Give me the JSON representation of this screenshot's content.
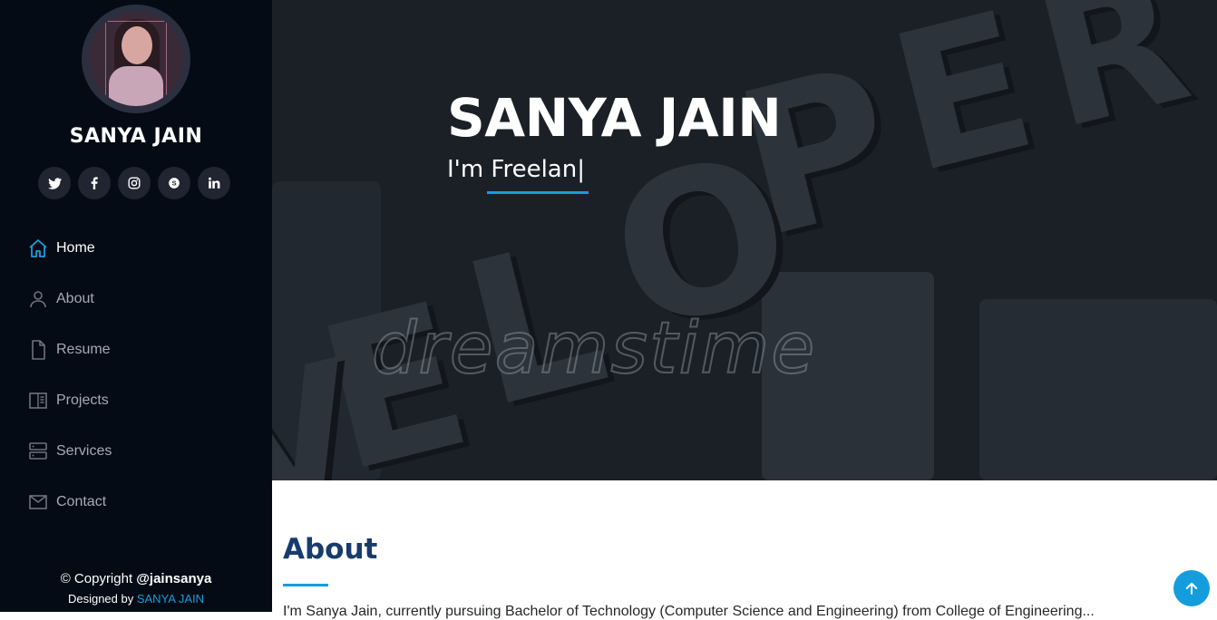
{
  "sidebar": {
    "name": "SANYA JAIN",
    "socials": [
      {
        "icon": "twitter-icon",
        "glyph": "t"
      },
      {
        "icon": "facebook-icon",
        "glyph": "f"
      },
      {
        "icon": "instagram-icon",
        "glyph": "◎"
      },
      {
        "icon": "skype-icon",
        "glyph": "S"
      },
      {
        "icon": "linkedin-icon",
        "glyph": "in"
      }
    ],
    "nav": [
      {
        "label": "Home",
        "icon": "home-icon",
        "active": true
      },
      {
        "label": "About",
        "icon": "person-icon",
        "active": false
      },
      {
        "label": "Resume",
        "icon": "file-icon",
        "active": false
      },
      {
        "label": "Projects",
        "icon": "book-icon",
        "active": false
      },
      {
        "label": "Services",
        "icon": "server-icon",
        "active": false
      },
      {
        "label": "Contact",
        "icon": "envelope-icon",
        "active": false
      }
    ],
    "footer": {
      "copyright_prefix": "© Copyright ",
      "handle": "@jainsanya",
      "designed_prefix": "Designed by ",
      "designer": "SANYA JAIN"
    }
  },
  "hero": {
    "title": "SANYA JAIN",
    "typed_text": "I'm Freelan|",
    "watermark": "dreamstime"
  },
  "about": {
    "title": "About",
    "text_partial": "I'm Sanya Jain, currently pursuing Bachelor of Technology (Computer Science and Engineering) from College of Engineering..."
  },
  "colors": {
    "accent": "#149ddd",
    "sidebar_bg": "#040b14",
    "heading": "#173b6c"
  }
}
